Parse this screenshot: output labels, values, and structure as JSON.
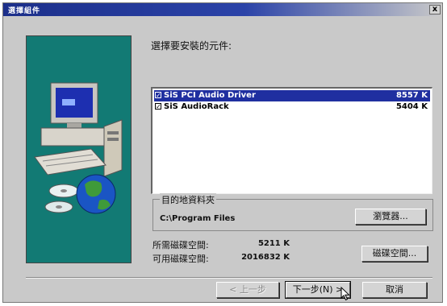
{
  "window": {
    "title": "選擇組件",
    "close_label": "x"
  },
  "prompt": "選擇要安裝的元件:",
  "components": [
    {
      "name": "SiS PCI Audio Driver",
      "size": "8557 K",
      "checked": true,
      "selected": true
    },
    {
      "name": "SiS AudioRack",
      "size": "5404 K",
      "checked": true,
      "selected": false
    }
  ],
  "destination": {
    "legend": "目的地資料夾",
    "path": "C:\\Program Files",
    "browse_label": "瀏覽器..."
  },
  "space": {
    "required_label": "所需磁碟空間:",
    "required_value": "5211 K",
    "available_label": "可用磁碟空間:",
    "available_value": "2016832 K",
    "disk_space_button": "磁碟空間..."
  },
  "nav": {
    "back_label": "< 上一步",
    "next_label": "下一步(N) >",
    "cancel_label": "取消"
  }
}
